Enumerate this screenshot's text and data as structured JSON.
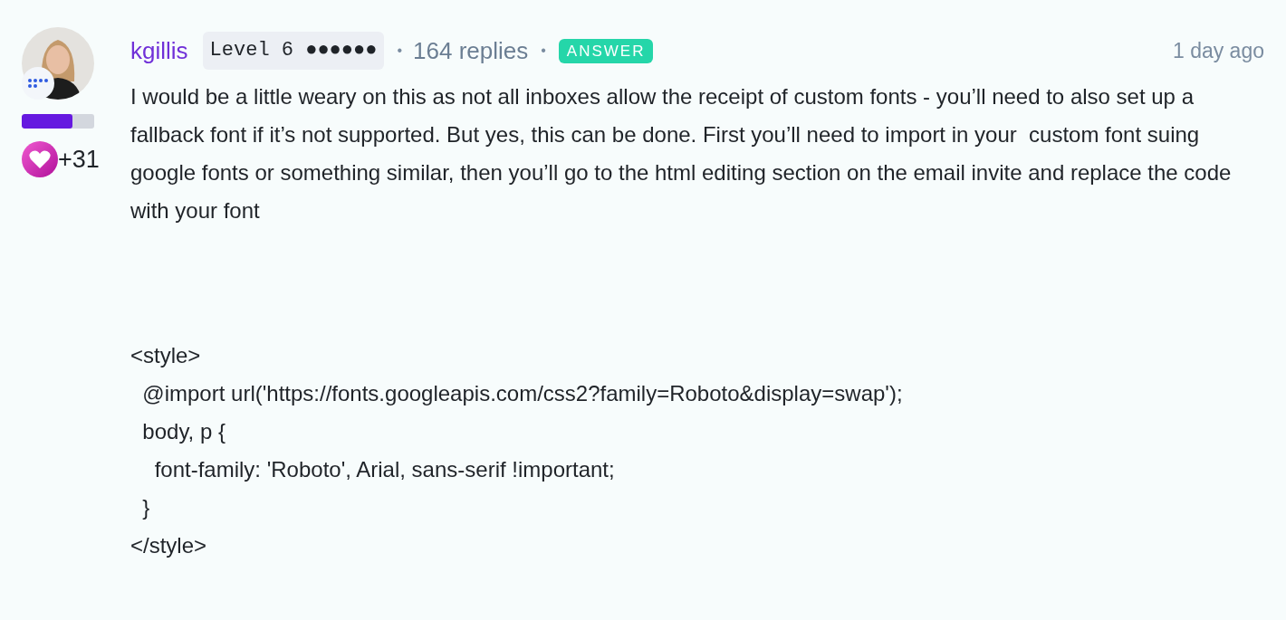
{
  "post": {
    "author": "kgillis",
    "rank_badge": "Level 6 ●●●●●●",
    "separator_1": "•",
    "reply_count": "164 replies",
    "separator_2": "•",
    "answer_tag": "ANSWER",
    "time": "1 day ago",
    "progress": {
      "level": 0.7
    },
    "kudos": "+31",
    "body": "I would be a little weary on this as not all inboxes allow the receipt of custom fonts - you’ll need to also set up a fallback font if it’s not supported. But yes, this can be done. First you’ll need to import in your  custom font suing google fonts or something similar, then you’ll go to the html editing section on the email invite and replace the code with your font",
    "code_lines": [
      "<style>",
      "  @import url('https://fonts.googleapis.com/css2?family=Roboto&display=swap');",
      "  body, p {",
      "    font-family: 'Roboto', Arial, sans-serif !important;",
      "  }",
      "</style>"
    ]
  }
}
